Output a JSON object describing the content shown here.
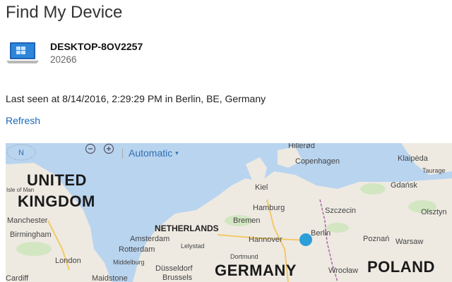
{
  "page": {
    "title": "Find My Device"
  },
  "device": {
    "name": "DESKTOP-8OV2257",
    "id": "20266",
    "icon": "laptop-icon"
  },
  "status": {
    "last_seen": "Last seen at 8/14/2016, 2:29:29 PM in Berlin, BE, Germany"
  },
  "actions": {
    "refresh": "Refresh"
  },
  "map": {
    "controls": {
      "compass_label": "N",
      "zoom_out_icon": "zoom-out-icon",
      "zoom_in_icon": "zoom-in-icon",
      "mode": "Automatic"
    },
    "countries": [
      "UNITED",
      "KINGDOM",
      "GERMANY",
      "POLAND"
    ],
    "regions": [
      "NETHERLANDS"
    ],
    "cities": [
      "Hillerød",
      "Copenhagen",
      "Klaipėda",
      "Taurage",
      "Kiel",
      "Gdańsk",
      "Hamburg",
      "Szczecin",
      "Olsztyn",
      "Bremen",
      "Berlin",
      "Poznań",
      "Warsaw",
      "Manchester",
      "Birmingham",
      "Amsterdam",
      "Rotterdam",
      "Lelystad",
      "Hannover",
      "London",
      "Middelburg",
      "Düsseldorf",
      "Wrocław",
      "Cardiff",
      "Maidstone",
      "Brussels",
      "Dortmund",
      "Isle of Man"
    ],
    "location_marker_color": "#2a9fd8"
  }
}
